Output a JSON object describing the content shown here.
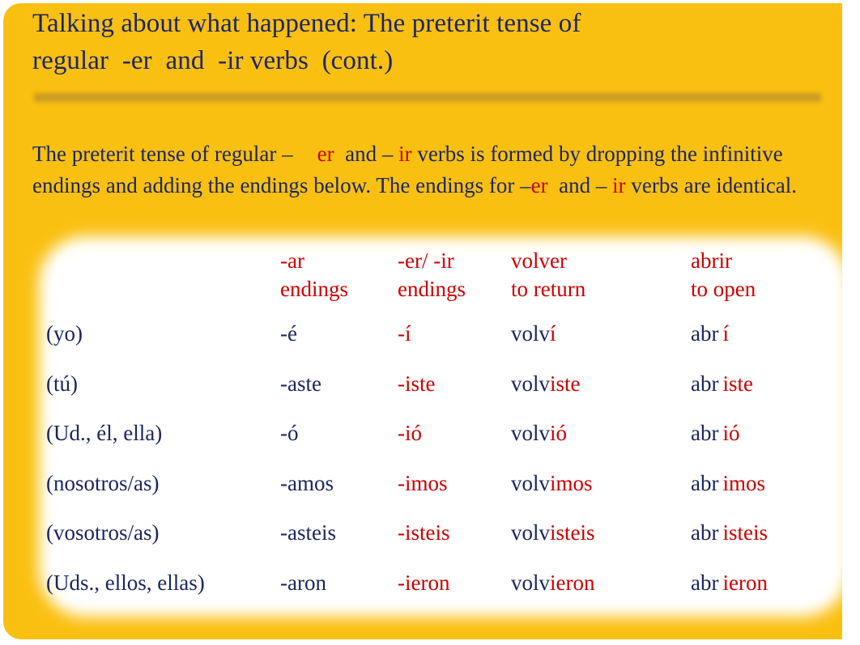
{
  "colors": {
    "slide_background": "#FAC011",
    "navy_text": "#1B2660",
    "red_text": "#CC0000",
    "panel": "#FFFFFF",
    "rule": "#C69A23"
  },
  "title": {
    "line1": "Talking about what happened: The preterit tense of",
    "line2": "regular  -er  and  -ir verbs  (cont.)"
  },
  "intro": {
    "seg1": "The preterit tense of regular –",
    "seg2_red": "er",
    "seg3": "and –",
    "seg4_red": "ir",
    "seg5": "verbs is formed by dropping the infinitive endings and adding the endings below. The endings for",
    "seg6": "–",
    "seg7_red": "er",
    "seg8": "and –",
    "seg9_red": "ir",
    "seg10": "verbs are identical."
  },
  "table": {
    "headers": {
      "pronoun": "",
      "ar": {
        "top": "-ar",
        "bottom": "endings"
      },
      "erir": {
        "top": "-er/ -ir",
        "bottom": "endings"
      },
      "volver": {
        "top": "volver",
        "bottom": "to return"
      },
      "abrir": {
        "top": "abrir",
        "bottom": "to open"
      }
    },
    "rows": [
      {
        "pronoun": "(yo)",
        "ar": "-é",
        "erir": "-í",
        "volver_stem": "volv",
        "volver_ending": "í",
        "abrir_stem": "abr",
        "abrir_ending": "í"
      },
      {
        "pronoun": "(tú)",
        "ar": "-aste",
        "erir": "-iste",
        "volver_stem": "volv",
        "volver_ending": "iste",
        "abrir_stem": "abr",
        "abrir_ending": "iste"
      },
      {
        "pronoun": "(Ud., él, ella)",
        "ar": "-ó",
        "erir": "-ió",
        "volver_stem": "volv",
        "volver_ending": "ió",
        "abrir_stem": "abr",
        "abrir_ending": "ió"
      },
      {
        "pronoun": "(nosotros/as)",
        "ar": "-amos",
        "erir": "-imos",
        "volver_stem": "volv",
        "volver_ending": "imos",
        "abrir_stem": "abr",
        "abrir_ending": "imos"
      },
      {
        "pronoun": "(vosotros/as)",
        "ar": "-asteis",
        "erir": "-isteis",
        "volver_stem": "volv",
        "volver_ending": "isteis",
        "abrir_stem": "abr",
        "abrir_ending": "isteis"
      },
      {
        "pronoun": "(Uds., ellos, ellas)",
        "ar": "-aron",
        "erir": "-ieron",
        "volver_stem": "volv",
        "volver_ending": "ieron",
        "abrir_stem": "abr",
        "abrir_ending": "ieron"
      }
    ]
  }
}
